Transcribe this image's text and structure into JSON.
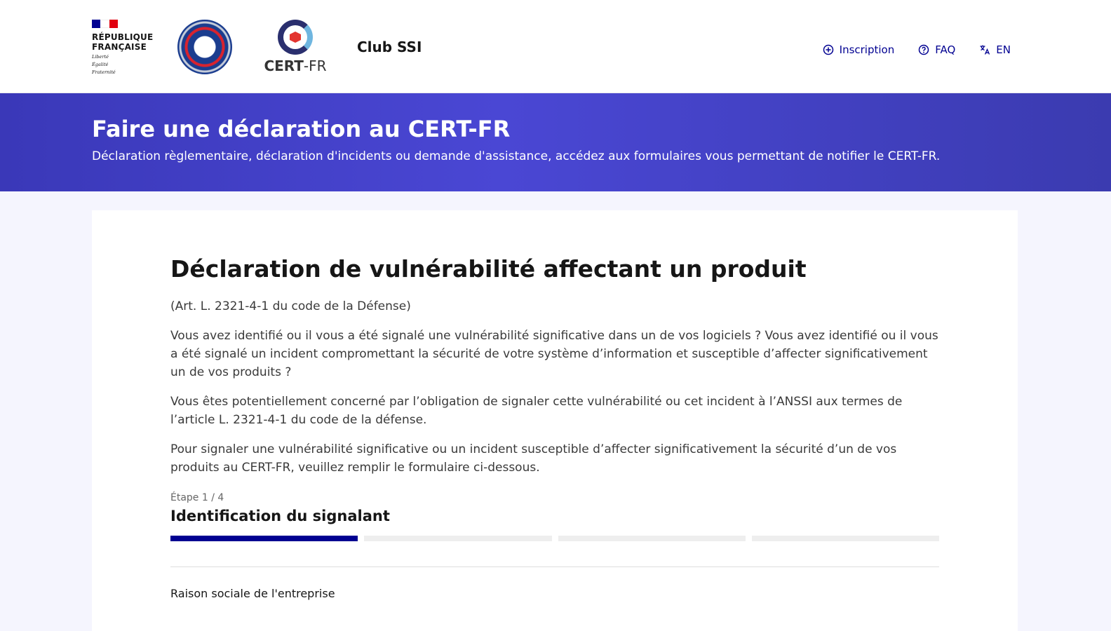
{
  "header": {
    "marianne": {
      "line1": "RÉPUBLIQUE",
      "line2": "FRANÇAISE",
      "devise1": "Liberté",
      "devise2": "Égalité",
      "devise3": "Fraternité"
    },
    "cert_logo": {
      "bold": "CERT",
      "light": "-FR"
    },
    "service_name": "Club SSI",
    "tools": {
      "inscription": "Inscription",
      "faq": "FAQ",
      "lang": "EN"
    }
  },
  "hero": {
    "title": "Faire une déclaration au CERT-FR",
    "subtitle": "Déclaration règlementaire, déclaration d'incidents ou demande d'assistance, accédez aux formulaires vous permettant de notifier le CERT-FR."
  },
  "form": {
    "title": "Déclaration de vulnérabilité affectant un produit",
    "law_ref": "(Art. L. 2321-4-1 du code de la Défense)",
    "paragraphs": [
      "Vous avez identifié ou il vous a été signalé une vulnérabilité significative dans un de vos logiciels ? Vous avez identifié ou il vous a été signalé un incident compromettant la sécurité de votre système d’information et susceptible d’affecter significativement un de vos produits ?",
      "Vous êtes potentiellement concerné par l’obligation de signaler cette vulnérabilité ou cet incident à l’ANSSI aux termes de l’article L. 2321-4-1 du code de la défense.",
      "Pour signaler une vulnérabilité significative ou un incident susceptible d’affecter significativement la sécurité d’un de vos produits au CERT-FR, veuillez remplir le formulaire ci-dessous."
    ],
    "step_label": "Étape 1 / 4",
    "step_title": "Identification du signalant",
    "step_current": 1,
    "step_total": 4,
    "first_field_label": "Raison sociale de l'entreprise"
  },
  "colors": {
    "accent": "#000091",
    "hero": "#4a47d4"
  }
}
